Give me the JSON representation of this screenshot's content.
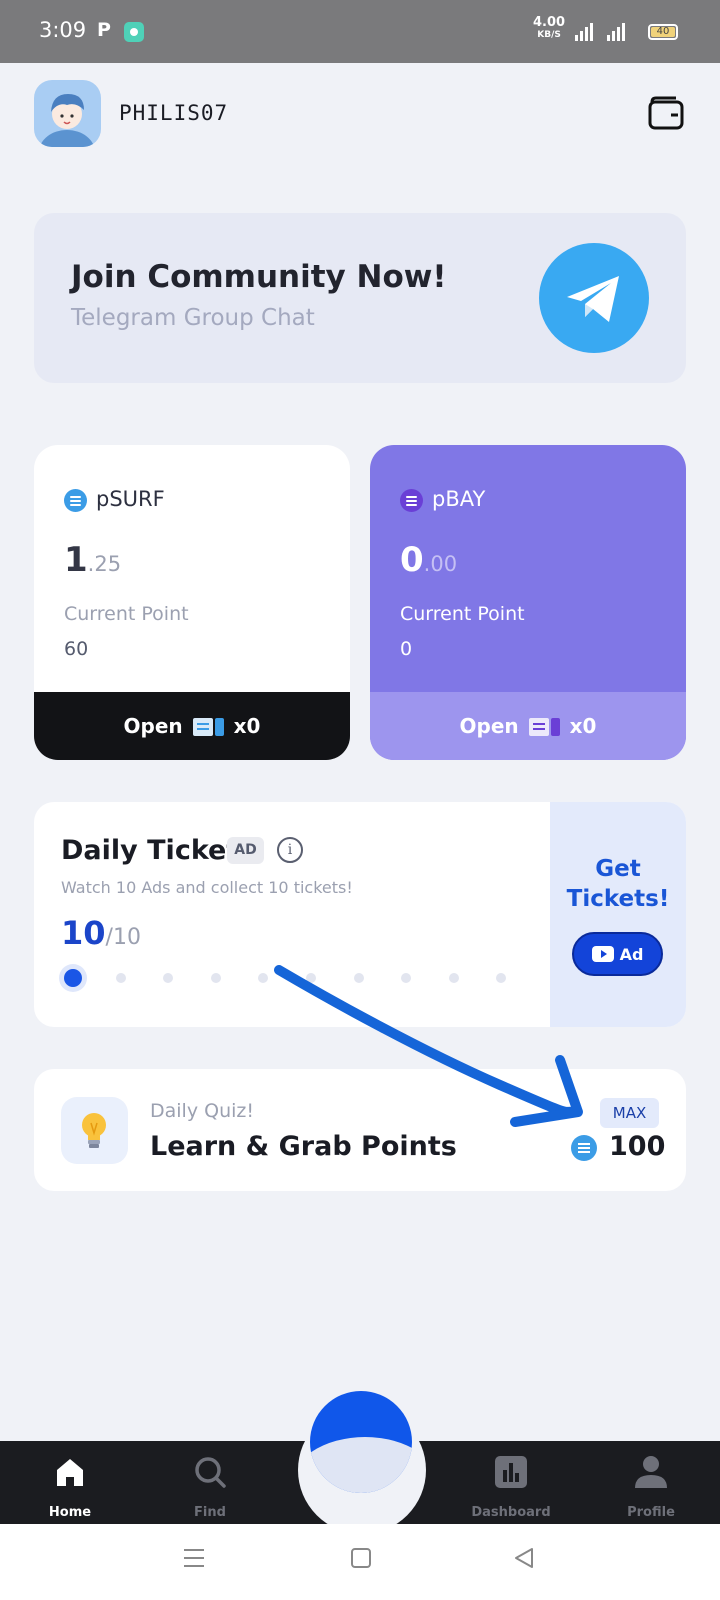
{
  "status_bar": {
    "time": "3:09",
    "speed_value": "4.00",
    "speed_unit": "KB/S",
    "battery": "40"
  },
  "header": {
    "username": "PHILIS07"
  },
  "banner": {
    "title": "Join Community Now!",
    "subtitle": "Telegram Group Chat"
  },
  "cards": [
    {
      "name": "pSURF",
      "value_int": "1",
      "value_dec": ".25",
      "point_label": "Current Point",
      "points": "60",
      "open_label": "Open",
      "ticket_count": "x0"
    },
    {
      "name": "pBAY",
      "value_int": "0",
      "value_dec": ".00",
      "point_label": "Current Point",
      "points": "0",
      "open_label": "Open",
      "ticket_count": "x0"
    }
  ],
  "daily_ticket": {
    "title": "Daily Ticket",
    "badge": "AD",
    "info": "i",
    "description": "Watch 10 Ads and collect 10 tickets!",
    "count": "10",
    "total": "/10",
    "get_label_1": "Get",
    "get_label_2": "Tickets!",
    "ad_button": "Ad",
    "progress_dots": 10,
    "active_dot": 1
  },
  "quiz": {
    "subtitle": "Daily Quiz!",
    "title": "Learn & Grab Points",
    "badge": "MAX",
    "points": "100"
  },
  "nav": {
    "home": "Home",
    "find": "Find",
    "dashboard": "Dashboard",
    "profile": "Profile"
  },
  "colors": {
    "primary": "#1a56e6",
    "purple": "#8077e6",
    "dark": "#1b1c20",
    "telegram": "#39a9f2",
    "annotation_arrow": "#1565d8"
  }
}
